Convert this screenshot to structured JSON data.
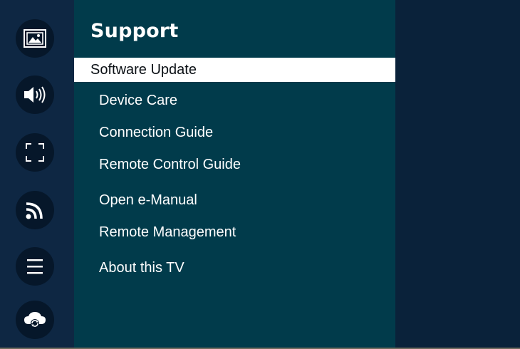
{
  "panel": {
    "title": "Support"
  },
  "menu": {
    "items": [
      {
        "label": "Software Update",
        "selected": true
      },
      {
        "label": "Device Care"
      },
      {
        "label": "Connection Guide"
      },
      {
        "label": "Remote Control Guide"
      },
      {
        "label": "Open e-Manual"
      },
      {
        "label": "Remote Management"
      },
      {
        "label": "About this TV"
      }
    ]
  },
  "rail": {
    "icons": [
      "picture-icon",
      "sound-icon",
      "screen-fullscreen-icon",
      "broadcast-icon",
      "general-menu-icon",
      "support-cloud-icon"
    ]
  },
  "colors": {
    "rail": "#0e2743",
    "panel": "#013b4b",
    "background": "#0a223a",
    "selected": "#ffffff"
  }
}
